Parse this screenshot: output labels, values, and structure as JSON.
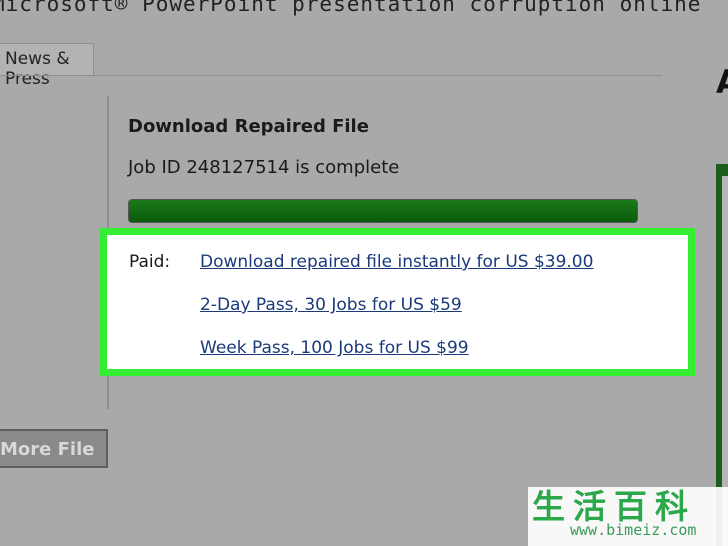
{
  "header": {
    "title": "Microsoft® PowerPoint presentation corruption online"
  },
  "tabs": [
    {
      "label": "News & Press"
    }
  ],
  "main": {
    "heading": "Download Repaired File",
    "status": "Job ID 248127514 is complete",
    "progress": 1.0,
    "paid_label": "Paid:",
    "links": [
      "Download repaired file instantly for US $39.00",
      "2-Day Pass, 30 Jobs for US $59",
      "Week Pass, 100 Jobs for US $99"
    ]
  },
  "actions": {
    "more_file_label": "More File"
  },
  "right_panel": {
    "letters": "AF"
  },
  "watermark": {
    "chars": "生活百科",
    "url": "www.bimeiz.com"
  },
  "colors": {
    "highlight": "#33ee33",
    "progress": "#137013",
    "link": "#1a3a7a"
  }
}
